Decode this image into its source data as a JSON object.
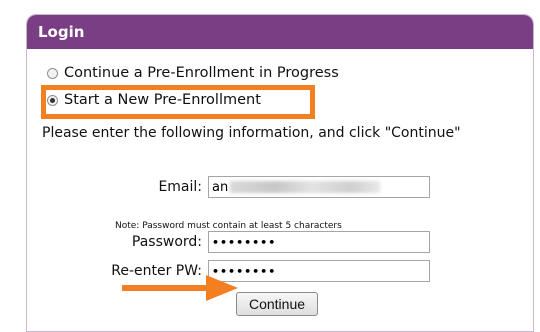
{
  "login": {
    "title": "Login",
    "options": [
      {
        "label": "Continue a Pre-Enrollment in Progress",
        "selected": false
      },
      {
        "label": "Start a New Pre-Enrollment",
        "selected": true
      }
    ],
    "instructions": "Please enter the following information, and click \"Continue\"",
    "email": {
      "label": "Email:",
      "value": "an"
    },
    "note": "Note: Password must contain at least 5 characters",
    "password": {
      "label": "Password:",
      "value": "••••••••"
    },
    "reenter": {
      "label": "Re-enter PW:",
      "value": "••••••••"
    },
    "continue_label": "Continue"
  },
  "annotations": {
    "highlight_color": "#f47f20",
    "arrow_color": "#f47f20"
  },
  "colors": {
    "header_bg": "#7a3e84",
    "panel_border": "#c9b8d6"
  }
}
